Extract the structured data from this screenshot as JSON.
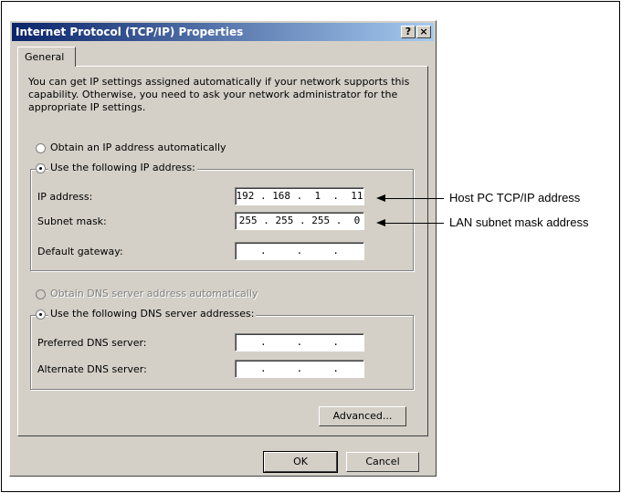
{
  "dialog": {
    "title": "Internet Protocol (TCP/IP) Properties",
    "help_button": "?",
    "close_button": "×",
    "tab_general": "General",
    "description": "You can get IP settings assigned automatically if your network supports this capability. Otherwise, you need to ask your network administrator for the appropriate IP settings.",
    "radio_obtain_ip": "Obtain an IP address automatically",
    "radio_use_ip": "Use the following IP address:",
    "ip_address_label": "IP address:",
    "ip_address_value": "192 . 168 .  1  .  11",
    "subnet_label": "Subnet mask:",
    "subnet_value": "255 . 255 . 255 .  0",
    "gateway_label": "Default gateway:",
    "gateway_value": "   .     .     .   ",
    "radio_obtain_dns": "Obtain DNS server address automatically",
    "radio_use_dns": "Use the following DNS server addresses:",
    "preferred_dns_label": "Preferred DNS server:",
    "preferred_dns_value": "   .     .     .   ",
    "alternate_dns_label": "Alternate DNS server:",
    "alternate_dns_value": "   .     .     .   ",
    "advanced_button": "Advanced...",
    "ok_button": "OK",
    "cancel_button": "Cancel"
  },
  "callouts": {
    "host_pc": "Host PC TCP/IP address",
    "lan_subnet": "LAN subnet mask address"
  },
  "colors": {
    "dialog_face": "#d4d0c8",
    "titlebar_start": "#0a246a",
    "titlebar_end": "#a6caf0"
  }
}
